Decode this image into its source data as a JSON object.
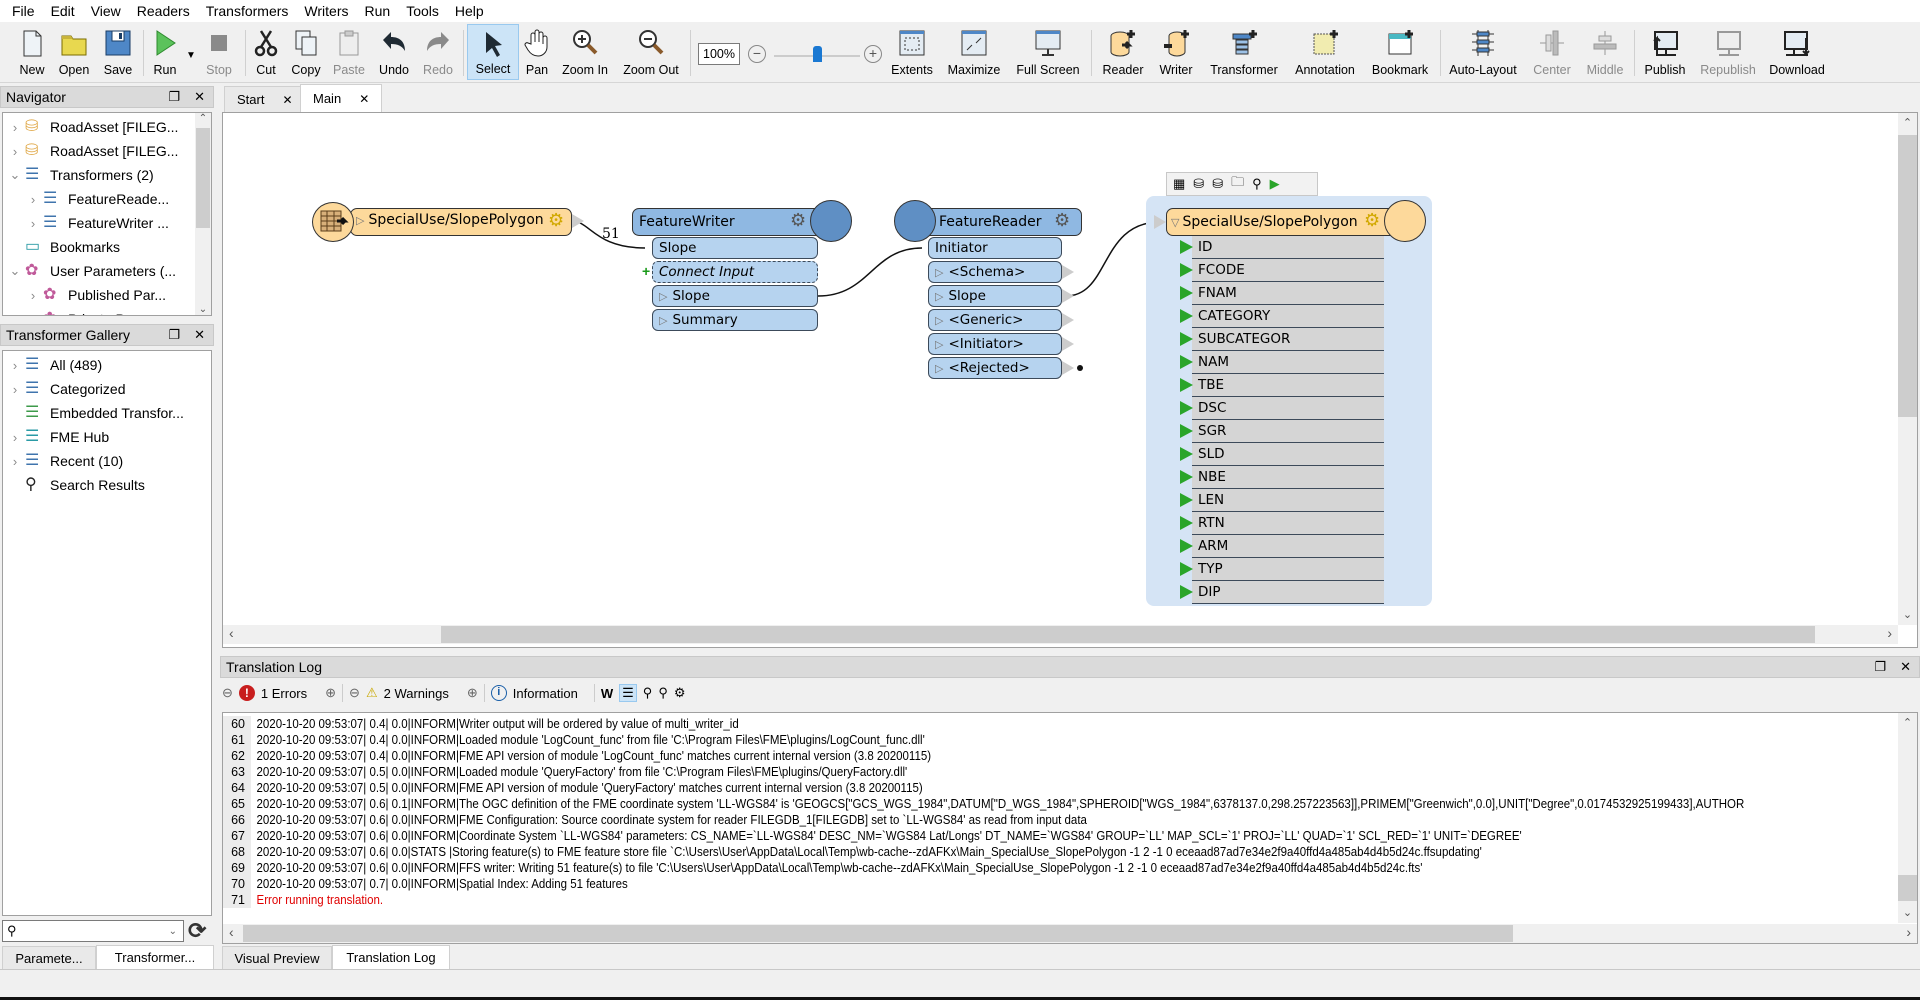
{
  "menu": [
    "File",
    "Edit",
    "View",
    "Readers",
    "Transformers",
    "Writers",
    "Run",
    "Tools",
    "Help"
  ],
  "toolbar": {
    "new": "New",
    "open": "Open",
    "save": "Save",
    "run": "Run",
    "stop": "Stop",
    "cut": "Cut",
    "copy": "Copy",
    "paste": "Paste",
    "undo": "Undo",
    "redo": "Redo",
    "select": "Select",
    "pan": "Pan",
    "zoom_in": "Zoom In",
    "zoom_out": "Zoom Out",
    "zoom_value": "100%",
    "zoom_slider_percent": 50,
    "extents": "Extents",
    "maximize": "Maximize",
    "full_screen": "Full Screen",
    "reader": "Reader",
    "writer": "Writer",
    "transformer": "Transformer",
    "annotation": "Annotation",
    "bookmark": "Bookmark",
    "auto_layout": "Auto-Layout",
    "center": "Center",
    "middle": "Middle",
    "publish": "Publish",
    "republish": "Republish",
    "download": "Download"
  },
  "navigator": {
    "title": "Navigator",
    "items": [
      {
        "label": "RoadAsset [FILEG...",
        "expander": ">"
      },
      {
        "label": "RoadAsset [FILEG...",
        "expander": ">"
      },
      {
        "label": "Transformers (2)",
        "expander": "v"
      },
      {
        "label": "FeatureReade...",
        "expander": ">"
      },
      {
        "label": "FeatureWriter ...",
        "expander": ">"
      },
      {
        "label": "Bookmarks",
        "expander": ""
      },
      {
        "label": "User Parameters (...",
        "expander": "v"
      },
      {
        "label": "Published Par...",
        "expander": ">"
      },
      {
        "label": "Private Param...",
        "expander": ""
      }
    ]
  },
  "gallery": {
    "title": "Transformer Gallery",
    "items": [
      {
        "label": "All (489)"
      },
      {
        "label": "Categorized"
      },
      {
        "label": "Embedded Transfor..."
      },
      {
        "label": "FME Hub"
      },
      {
        "label": "Recent (10)"
      },
      {
        "label": "Search Results"
      }
    ],
    "search_placeholder": ""
  },
  "tabs": {
    "start": "Start",
    "main": "Main"
  },
  "canvas": {
    "reader_feature": "SpecialUse/SlopePolygon",
    "connection_count": "51",
    "feature_writer": {
      "title": "FeatureWriter",
      "input": "Slope",
      "connect_input": "Connect Input",
      "outputs": [
        "Slope",
        "Summary"
      ]
    },
    "feature_reader": {
      "title": "FeatureReader",
      "input": "Initiator",
      "outputs": [
        "<Schema>",
        "Slope",
        "<Generic>",
        "<Initiator>",
        "<Rejected>"
      ]
    },
    "writer_feature": {
      "title": "SpecialUse/SlopePolygon",
      "attributes": [
        "ID",
        "FCODE",
        "FNAM",
        "CATEGORY",
        "SUBCATEGOR",
        "NAM",
        "TBE",
        "DSC",
        "SGR",
        "SLD",
        "NBE",
        "LEN",
        "RTN",
        "ARM",
        "TYP",
        "DIP"
      ]
    }
  },
  "log": {
    "title": "Translation Log",
    "errors": "1 Errors",
    "warnings": "2 Warnings",
    "information": "Information",
    "rows": [
      {
        "n": "60",
        "t": "2020-10-20 09:53:07|   0.4|  0.0|INFORM|Writer output will be ordered by value of multi_writer_id"
      },
      {
        "n": "61",
        "t": "2020-10-20 09:53:07|   0.4|  0.0|INFORM|Loaded module 'LogCount_func' from file 'C:\\Program Files\\FME\\plugins/LogCount_func.dll'"
      },
      {
        "n": "62",
        "t": "2020-10-20 09:53:07|   0.4|  0.0|INFORM|FME API version of module 'LogCount_func' matches current internal version (3.8 20200115)"
      },
      {
        "n": "63",
        "t": "2020-10-20 09:53:07|   0.5|  0.0|INFORM|Loaded module 'QueryFactory' from file 'C:\\Program Files\\FME\\plugins/QueryFactory.dll'"
      },
      {
        "n": "64",
        "t": "2020-10-20 09:53:07|   0.5|  0.0|INFORM|FME API version of module 'QueryFactory' matches current internal version (3.8 20200115)"
      },
      {
        "n": "65",
        "t": "2020-10-20 09:53:07|   0.6|  0.1|INFORM|The OGC definition of the FME coordinate system 'LL-WGS84' is 'GEOGCS[\"GCS_WGS_1984\",DATUM[\"D_WGS_1984\",SPHEROID[\"WGS_1984\",6378137.0,298.257223563]],PRIMEM[\"Greenwich\",0.0],UNIT[\"Degree\",0.0174532925199433],AUTHOR"
      },
      {
        "n": "66",
        "t": "2020-10-20 09:53:07|   0.6|  0.0|INFORM|FME Configuration: Source coordinate system for reader FILEGDB_1[FILEGDB] set to `LL-WGS84' as read from input data"
      },
      {
        "n": "67",
        "t": "2020-10-20 09:53:07|   0.6|  0.0|INFORM|Coordinate System `LL-WGS84' parameters: CS_NAME=`LL-WGS84' DESC_NM=`WGS84 Lat/Longs' DT_NAME=`WGS84' GROUP=`LL' MAP_SCL=`1' PROJ=`LL' QUAD=`1' SCL_RED=`1' UNIT=`DEGREE'"
      },
      {
        "n": "68",
        "t": "2020-10-20 09:53:07|   0.6|  0.0|STATS |Storing feature(s) to FME feature store file `C:\\Users\\User\\AppData\\Local\\Temp\\wb-cache--zdAFKx\\Main_SpecialUse_SlopePolygon -1 2 -1  0  eceaad87ad7e34e2f9a40ffd4a485ab4d4b5d24c.ffsupdating'"
      },
      {
        "n": "69",
        "t": "2020-10-20 09:53:07|   0.6|  0.0|INFORM|FFS writer: Writing 51 feature(s) to file 'C:\\Users\\User\\AppData\\Local\\Temp\\wb-cache--zdAFKx\\Main_SpecialUse_SlopePolygon -1 2 -1  0  eceaad87ad7e34e2f9a40ffd4a485ab4d4b5d24c.fts'"
      },
      {
        "n": "70",
        "t": "2020-10-20 09:53:07|   0.7|  0.0|INFORM|Spatial Index: Adding 51 features"
      },
      {
        "n": "71",
        "t": "Error running translation.",
        "error": true
      }
    ]
  },
  "bottom_tabs": {
    "parameters": "Paramete...",
    "transformer": "Transformer...",
    "visual_preview": "Visual Preview",
    "translation_log": "Translation Log"
  },
  "colors": {
    "reader_node": "#fdd99b",
    "transformer_node": "#b6d3ef",
    "error_text": "#e00000",
    "selection": "#cce4f7"
  }
}
